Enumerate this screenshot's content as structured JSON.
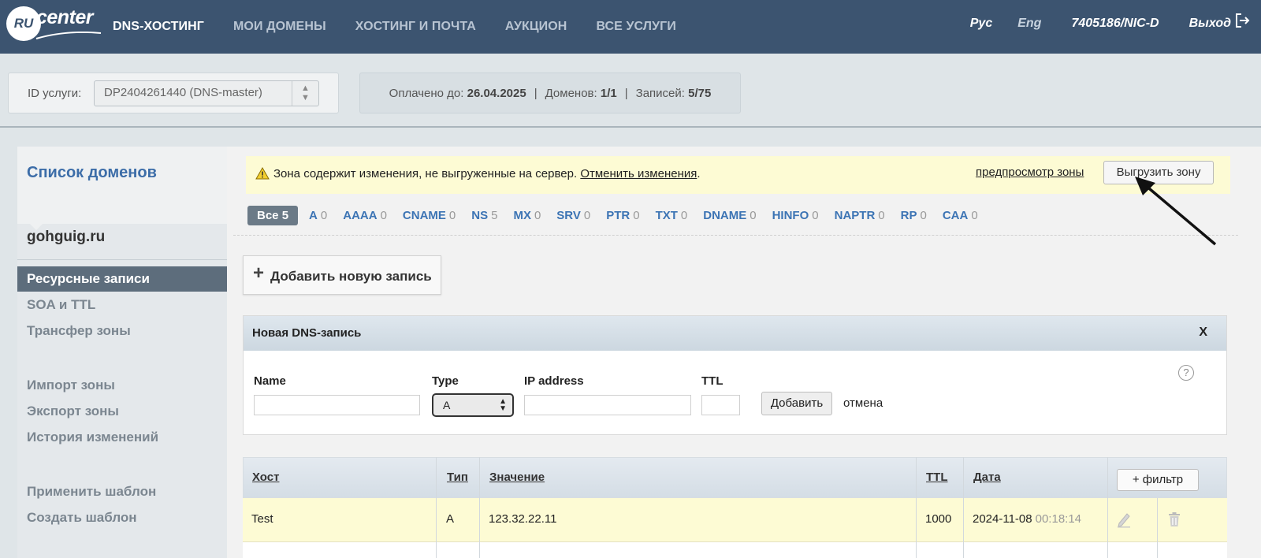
{
  "header": {
    "logo_ru": "RU",
    "logo_text": "center",
    "nav": [
      {
        "label": "DNS-ХОСТИНГ",
        "active": true
      },
      {
        "label": "МОИ ДОМЕНЫ",
        "active": false
      },
      {
        "label": "ХОСТИНГ И ПОЧТА",
        "active": false
      },
      {
        "label": "АУКЦИОН",
        "active": false
      },
      {
        "label": "ВСЕ УСЛУГИ",
        "active": false
      }
    ],
    "lang_ru": "Рус",
    "lang_en": "Eng",
    "account": "7405186/NIC-D",
    "logout": "Выход"
  },
  "service": {
    "label": "ID услуги:",
    "selected": "DP2404261440 (DNS-master)",
    "paid_label": "Оплачено до:",
    "paid_value": "26.04.2025",
    "domains_label": "Доменов:",
    "domains_value": "1/1",
    "records_label": "Записей:",
    "records_value": "5/75",
    "sep": "|"
  },
  "sidebar": {
    "title": "Список доменов",
    "domain": "gohguig.ru",
    "items": [
      {
        "label": "Ресурсные записи",
        "active": true
      },
      {
        "label": "SOA и TTL"
      },
      {
        "label": "Трансфер зоны"
      },
      {
        "label": "Импорт зоны"
      },
      {
        "label": "Экспорт зоны"
      },
      {
        "label": "История изменений"
      },
      {
        "label": "Применить шаблон"
      },
      {
        "label": "Создать шаблон"
      }
    ]
  },
  "alert": {
    "text": "Зона содержит изменения, не выгруженные на сервер.",
    "undo_link": "Отменить изменения",
    "dot": ".",
    "preview_link": "предпросмотр зоны",
    "upload_button": "Выгрузить зону"
  },
  "filters": [
    {
      "label": "Все",
      "count": "5",
      "active": true
    },
    {
      "label": "A",
      "count": "0"
    },
    {
      "label": "AAAA",
      "count": "0"
    },
    {
      "label": "CNAME",
      "count": "0"
    },
    {
      "label": "NS",
      "count": "5"
    },
    {
      "label": "MX",
      "count": "0"
    },
    {
      "label": "SRV",
      "count": "0"
    },
    {
      "label": "PTR",
      "count": "0"
    },
    {
      "label": "TXT",
      "count": "0"
    },
    {
      "label": "DNAME",
      "count": "0"
    },
    {
      "label": "HINFO",
      "count": "0"
    },
    {
      "label": "NAPTR",
      "count": "0"
    },
    {
      "label": "RP",
      "count": "0"
    },
    {
      "label": "CAA",
      "count": "0"
    }
  ],
  "add_record": {
    "plus": "+",
    "label": "Добавить новую запись"
  },
  "new_record": {
    "title": "Новая DNS-запись",
    "close": "X",
    "name_label": "Name",
    "type_label": "Type",
    "ip_label": "IP address",
    "ttl_label": "TTL",
    "type_value": "A",
    "add_button": "Добавить",
    "cancel": "отмена",
    "help": "?"
  },
  "table": {
    "headers": {
      "host": "Хост",
      "type": "Тип",
      "value": "Значение",
      "ttl": "TTL",
      "date": "Дата"
    },
    "filter_button": "+ фильтр",
    "rows": [
      {
        "host": "Test",
        "type": "A",
        "value": "123.32.22.11",
        "ttl": "1000",
        "date": "2024-11-08",
        "time": "00:18:14"
      }
    ]
  },
  "colors": {
    "header_bg": "#3c5470",
    "link": "#3c74b4",
    "alert_bg": "#fdfbd4",
    "active_filter": "#6b7a87"
  }
}
